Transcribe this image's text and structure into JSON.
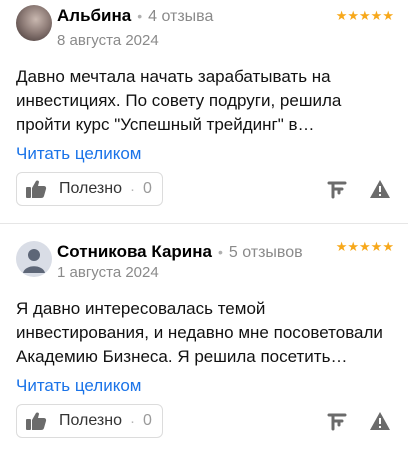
{
  "reviews": [
    {
      "author": "Альбина",
      "reviews_count": "4 отзыва",
      "date": "8 августа 2024",
      "stars": "★★★★★",
      "text": "Давно мечтала начать зарабатывать на инвестициях. По совету подруги, решила пройти курс \"Успешный трейдинг\" в…",
      "read_more": "Читать целиком",
      "useful_label": "Полезно",
      "useful_count": "0",
      "avatar": "user-photo"
    },
    {
      "author": "Сотникова Карина",
      "reviews_count": "5 отзывов",
      "date": "1 августа 2024",
      "stars": "★★★★★",
      "text": "Я давно интересовалась темой инвестирования, и недавно мне посоветовали Академию Бизнеса. Я решила посетить…",
      "read_more": "Читать целиком",
      "useful_label": "Полезно",
      "useful_count": "0",
      "avatar": "placeholder-avatar"
    }
  ],
  "colors": {
    "link": "#1a73e8",
    "stars": "#f7a81b",
    "muted": "#8a8a8a"
  }
}
